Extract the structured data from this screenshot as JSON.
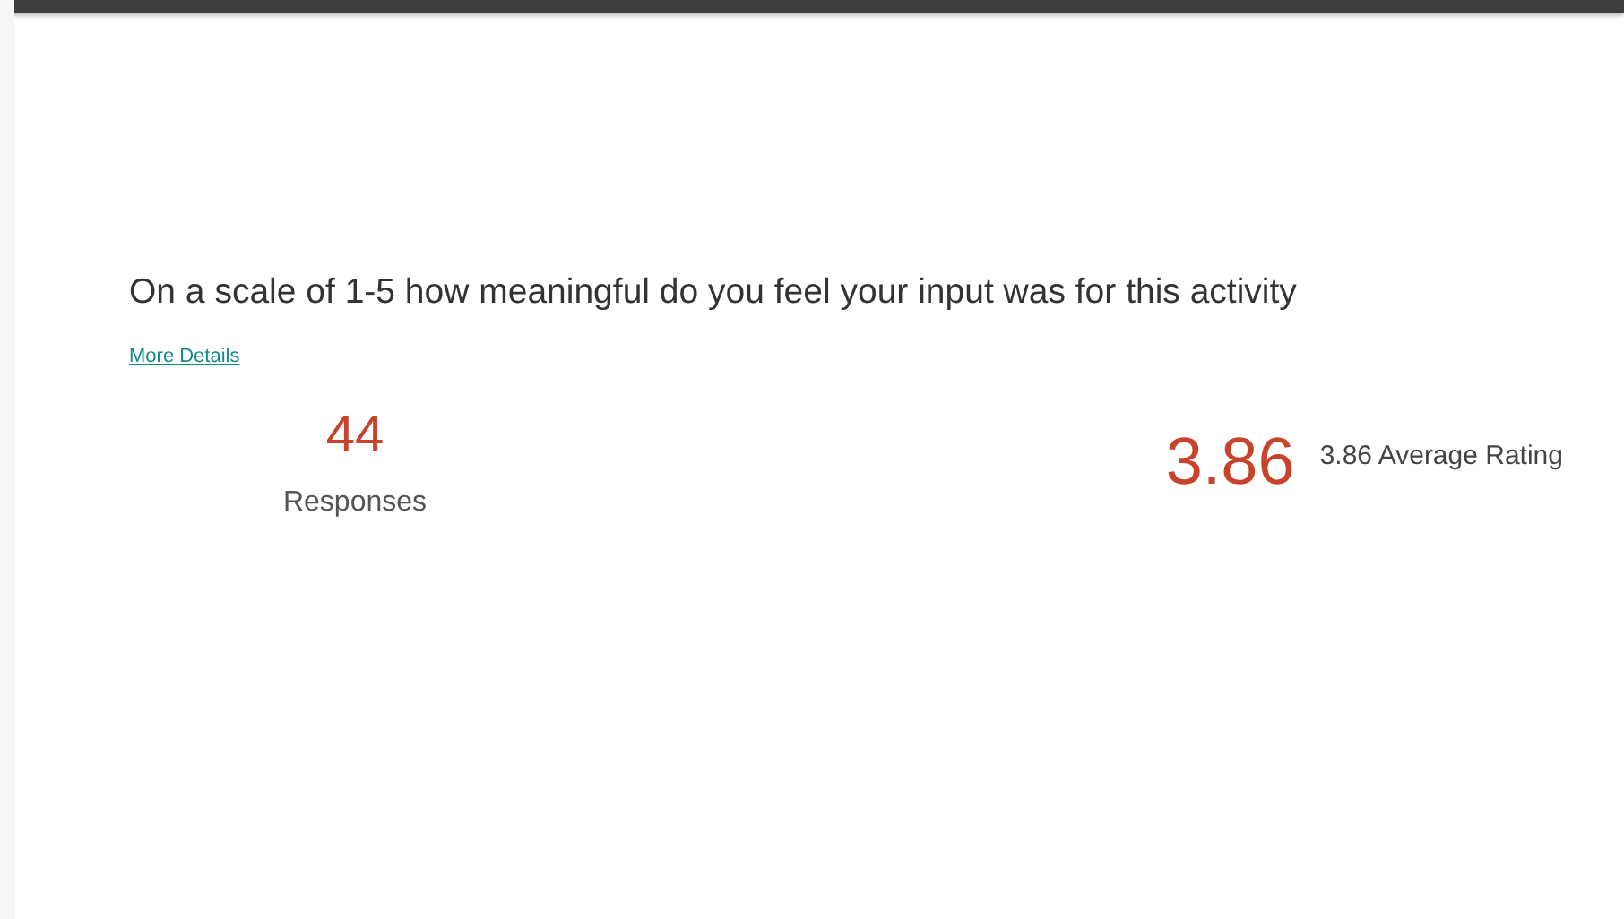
{
  "question": "On a scale of 1-5 how meaningful do you feel your input was for this activity",
  "details_link": "More Details",
  "responses": {
    "value": "44",
    "label": "Responses"
  },
  "average": {
    "value": "3.86",
    "label": "3.86 Average Rating"
  }
}
